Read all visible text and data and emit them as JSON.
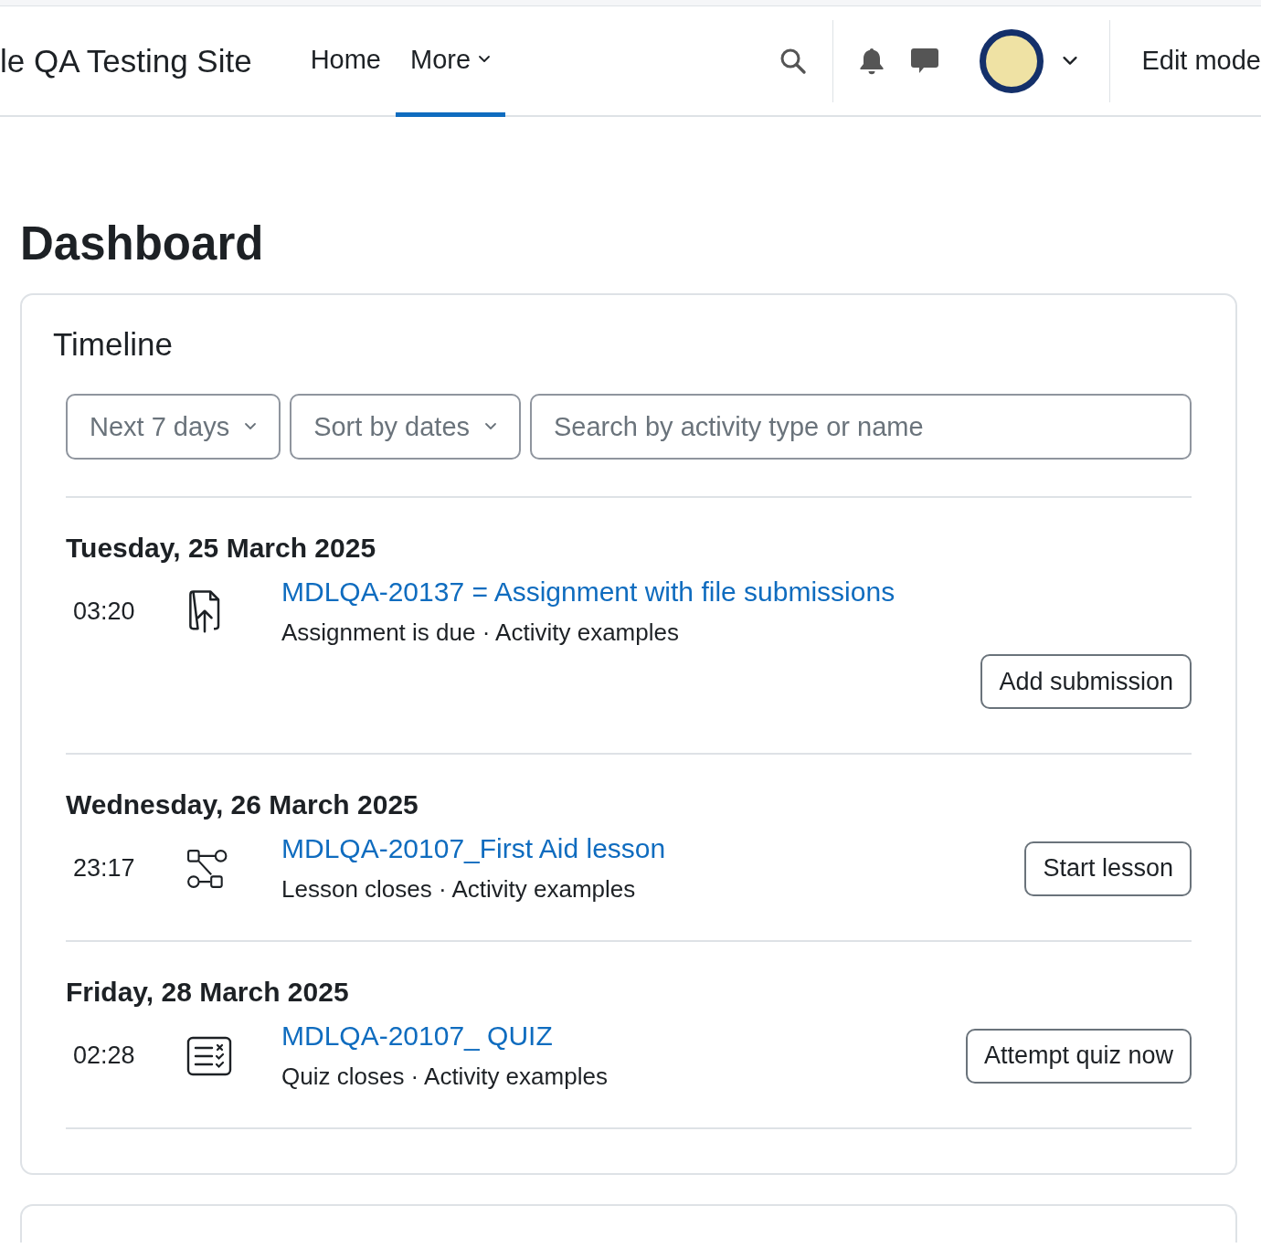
{
  "header": {
    "site_name": "le QA Testing Site",
    "nav": [
      {
        "label": "Home",
        "selected": false,
        "has_menu": false
      },
      {
        "label": "More",
        "selected": true,
        "has_menu": true
      }
    ],
    "edit_mode": "Edit mode"
  },
  "page_title": "Dashboard",
  "timeline": {
    "title": "Timeline",
    "filters": [
      {
        "label": "Next 7 days"
      },
      {
        "label": "Sort by dates"
      }
    ],
    "search": {
      "placeholder": "Search by activity type or name"
    },
    "days": [
      {
        "date": "Tuesday, 25 March 2025",
        "events": [
          {
            "time": "03:20",
            "kind": "assign",
            "name": "MDLQA-20137 = Assignment with file submissions",
            "details": "Assignment is due · Activity examples",
            "action": "Add submission"
          }
        ]
      },
      {
        "date": "Wednesday, 26 March 2025",
        "events": [
          {
            "time": "23:17",
            "kind": "lesson",
            "name": "MDLQA-20107_First Aid lesson",
            "details": "Lesson closes · Activity examples",
            "action": "Start lesson"
          }
        ]
      },
      {
        "date": "Friday, 28 March 2025",
        "events": [
          {
            "time": "02:28",
            "kind": "quiz",
            "name": "MDLQA-20107_ QUIZ",
            "details": "Quiz closes · Activity examples",
            "action": "Attempt quiz now"
          }
        ]
      }
    ]
  }
}
